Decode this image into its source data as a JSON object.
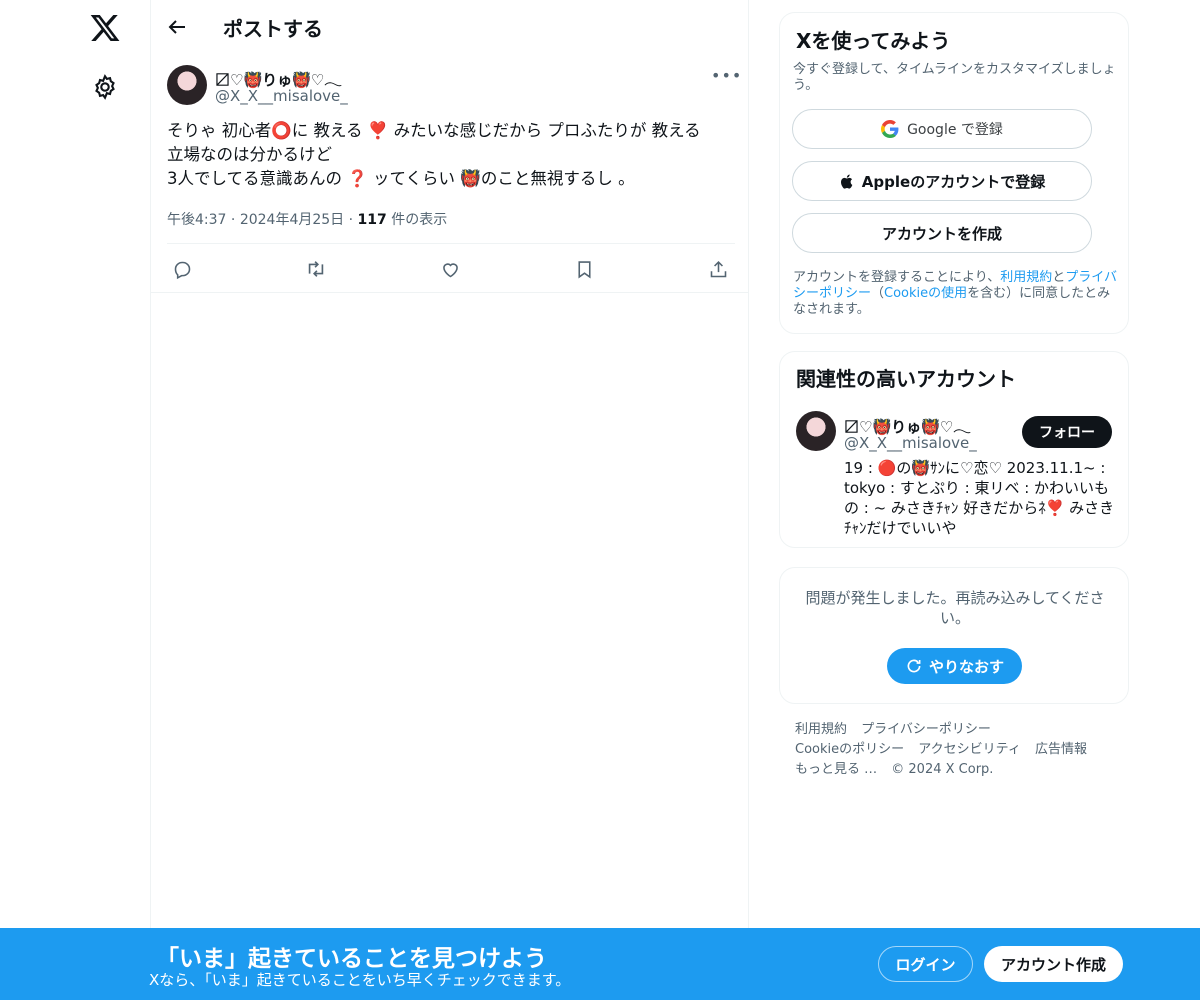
{
  "app": {
    "icons": {
      "logo": "x-logo-icon",
      "settings": "gear-icon"
    }
  },
  "header": {
    "title": "ポストする",
    "back_icon": "arrow-left-icon"
  },
  "post": {
    "author_name": "〼♡👹りゅ👹♡𓂃",
    "author_handle": "@X_X__misalove_",
    "more_icon": "more-dots-icon",
    "lines": [
      "そりゃ 初心者⭕️に 教える ❣️ みたいな感じだから プロふたりが 教える",
      "立場なのは分かるけど",
      "3人でしてる意識あんの ❓ ッてくらい 👹のこと無視するし 。"
    ],
    "time": "午後4:37",
    "date": "2024年4月25日",
    "views_count": "117",
    "views_label": "件の表示",
    "actions": [
      "reply-icon",
      "repost-icon",
      "like-icon",
      "bookmark-icon",
      "share-icon"
    ]
  },
  "signup": {
    "title": "Xを使ってみよう",
    "subtitle": "今すぐ登録して、タイムラインをカスタマイズしましょう。",
    "google_label": "Google で登録",
    "apple_label": "Appleのアカウントで登録",
    "create_label": "アカウントを作成",
    "terms_pre": "アカウントを登録することにより、",
    "terms_link1": "利用規約",
    "terms_mid1": "と",
    "terms_link2": "プライバシーポリシー",
    "terms_mid2": "（",
    "terms_link3": "Cookieの使用",
    "terms_post": "を含む）に同意したとみなされます。"
  },
  "related": {
    "title": "関連性の高いアカウント",
    "name": "〼♡👹りゅ👹♡𓂃",
    "handle": "@X_X__misalove_",
    "follow_label": "フォロー",
    "bio": "19 : 🔴の👹ｻﾝに♡恋♡ 2023.11.1~ : tokyo : すとぷり : 東リベ : かわいいもの : ~ みさきﾁｬﾝ 好きだからﾈ❣️ みさきﾁｬﾝだけでいいや"
  },
  "error": {
    "message": "問題が発生しました。再読み込みしてください。",
    "retry_label": "やりなおす",
    "retry_icon": "refresh-icon"
  },
  "footer": {
    "links": [
      "利用規約",
      "プライバシーポリシー",
      "Cookieのポリシー",
      "アクセシビリティ",
      "広告情報",
      "もっと見る …",
      "© 2024 X Corp."
    ]
  },
  "bottom_bar": {
    "title": "「いま」起きていることを見つけよう",
    "subtitle": "Xなら、「いま」起きていることをいち早くチェックできます。",
    "login_label": "ログイン",
    "create_label": "アカウント作成"
  },
  "colors": {
    "accent": "#1d9bf0",
    "text": "#0f1419",
    "muted": "#536471",
    "border": "#eff3f4"
  }
}
